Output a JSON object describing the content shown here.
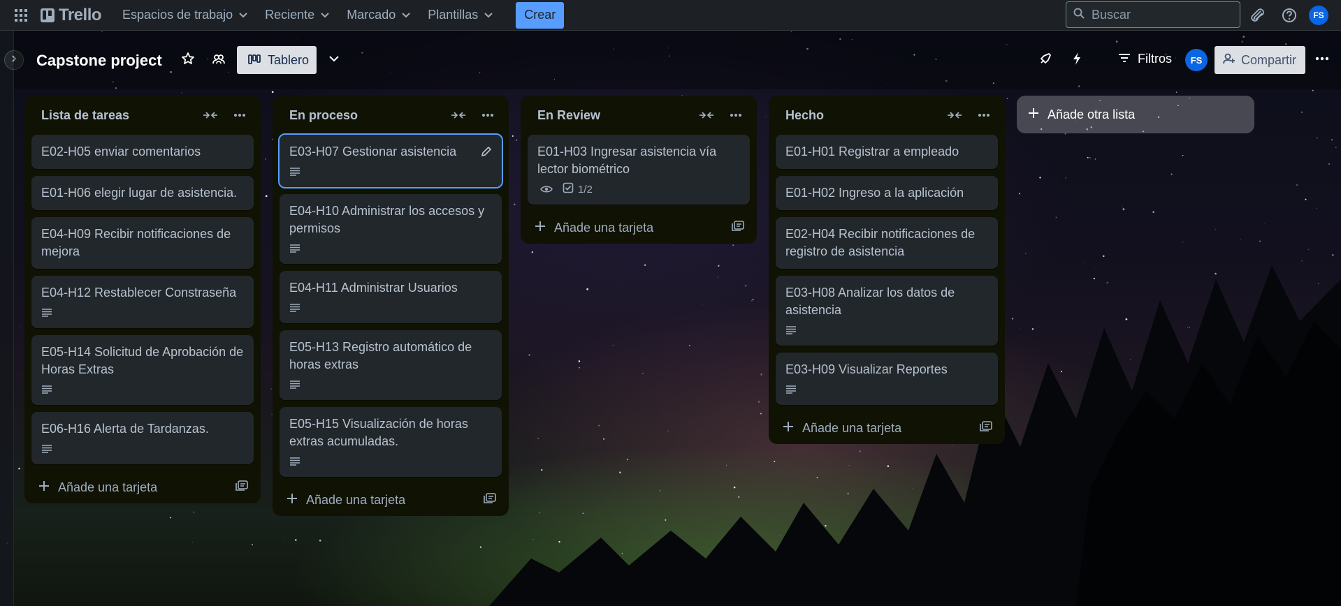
{
  "nav": {
    "brand": "Trello",
    "menus": [
      "Espacios de trabajo",
      "Reciente",
      "Marcado",
      "Plantillas"
    ],
    "create_label": "Crear",
    "search_placeholder": "Buscar",
    "avatar_initials": "FS"
  },
  "board": {
    "title": "Capstone project",
    "view_label": "Tablero",
    "filter_label": "Filtros",
    "share_label": "Compartir",
    "member_initials": "FS"
  },
  "lists": [
    {
      "title": "Lista de tareas",
      "cards": [
        {
          "text": "E02-H05 enviar comentarios",
          "description": false
        },
        {
          "text": "E01-H06 elegir lugar de asistencia.",
          "description": false
        },
        {
          "text": "E04-H09 Recibir notificaciones de mejora",
          "description": false
        },
        {
          "text": "E04-H12 Restablecer Constraseña",
          "description": true
        },
        {
          "text": "E05-H14 Solicitud de Aprobación de Horas Extras",
          "description": true
        },
        {
          "text": "E06-H16 Alerta de Tardanzas.",
          "description": true
        }
      ],
      "add_card_label": "Añade una tarjeta"
    },
    {
      "title": "En proceso",
      "cards": [
        {
          "text": "E03-H07 Gestionar asistencia",
          "description": true,
          "selected": true
        },
        {
          "text": "E04-H10 Administrar los accesos y permisos",
          "description": true
        },
        {
          "text": "E04-H11 Administrar Usuarios",
          "description": true
        },
        {
          "text": "E05-H13 Registro automático de horas extras",
          "description": true
        },
        {
          "text": "E05-H15 Visualización de horas extras acumuladas.",
          "description": true
        }
      ],
      "add_card_label": "Añade una tarjeta"
    },
    {
      "title": "En Review",
      "cards": [
        {
          "text": "E01-H03 Ingresar asistencia vía lector biométrico",
          "watching": true,
          "checklist": "1/2"
        }
      ],
      "add_card_label": "Añade una tarjeta"
    },
    {
      "title": "Hecho",
      "cards": [
        {
          "text": "E01-H01 Registrar a empleado",
          "description": false
        },
        {
          "text": "E01-H02 Ingreso a la aplicación",
          "description": false
        },
        {
          "text": "E02-H04 Recibir notificaciones de registro de asistencia",
          "description": false
        },
        {
          "text": "E03-H08 Analizar los datos de asistencia",
          "description": true
        },
        {
          "text": "E03-H09 Visualizar Reportes",
          "description": true
        }
      ],
      "add_card_label": "Añade una tarjeta"
    }
  ],
  "add_list_label": "Añade otra lista",
  "colors": {
    "accent": "#579dff",
    "nav_bg": "#1d2125",
    "list_bg": "#101204",
    "card_bg": "#22272b"
  }
}
